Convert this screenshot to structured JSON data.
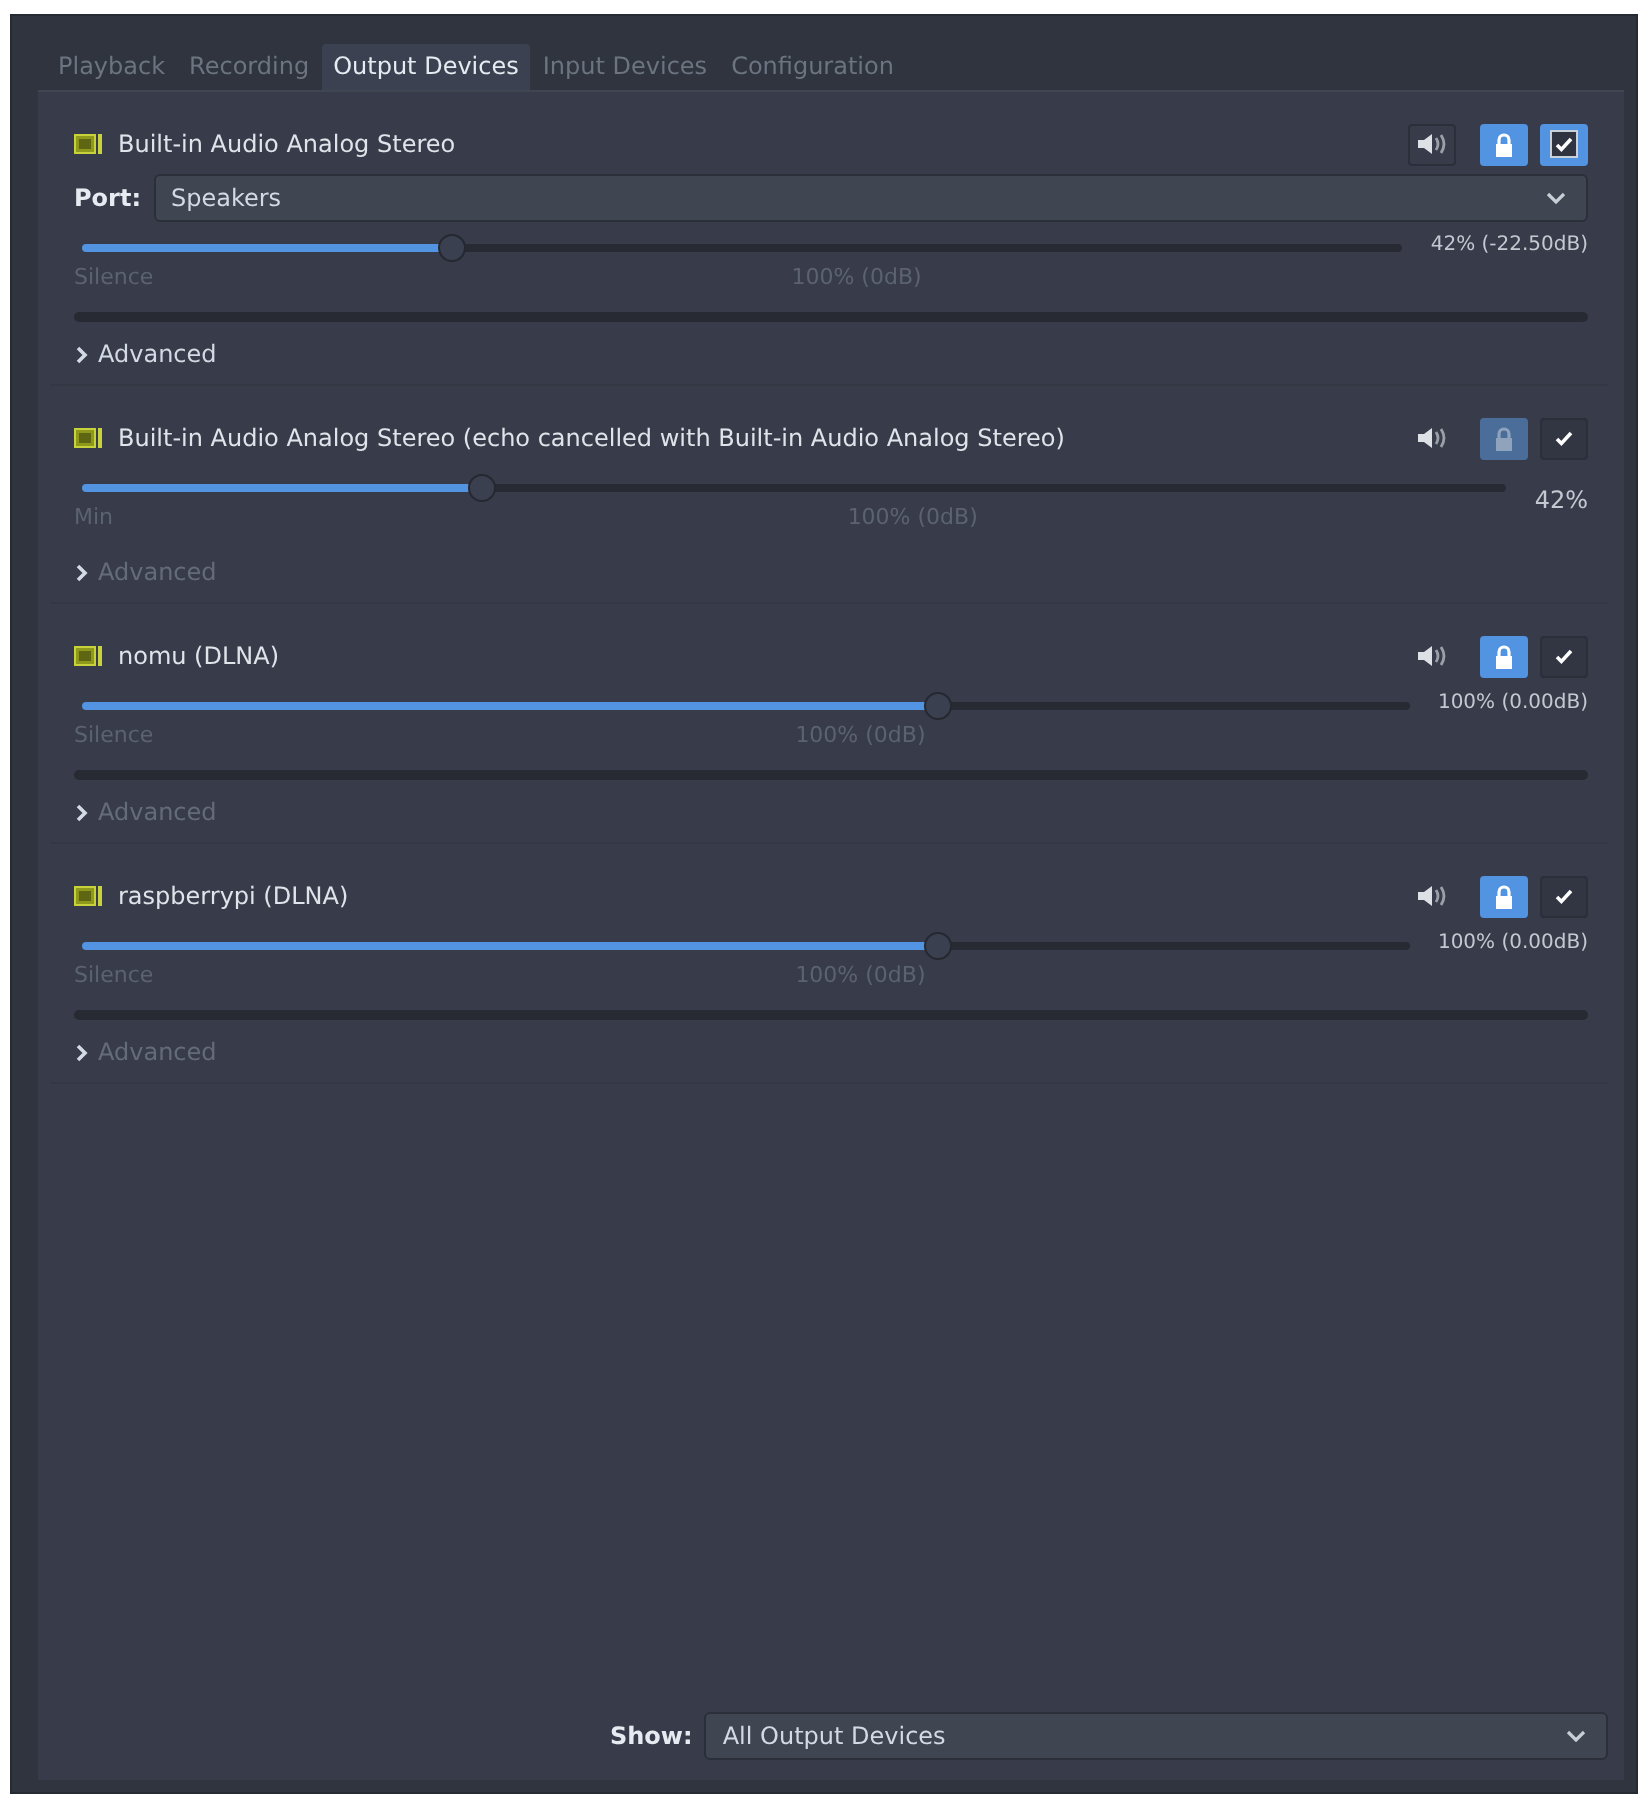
{
  "tabs": [
    {
      "label": "Playback",
      "selected": false
    },
    {
      "label": "Recording",
      "selected": false
    },
    {
      "label": "Output Devices",
      "selected": true
    },
    {
      "label": "Input Devices",
      "selected": false
    },
    {
      "label": "Configuration",
      "selected": false
    }
  ],
  "devices": [
    {
      "name": "Built-in Audio Analog Stereo",
      "muted": false,
      "lock": true,
      "lock_disabled": false,
      "default": true,
      "port_label": "Port:",
      "port": "Speakers",
      "level": 0.28,
      "reading": "42% (-22.50dB)",
      "min_label": "Silence",
      "mid_label": "100% (0dB)",
      "meter": true,
      "advanced": "Advanced",
      "advanced_enabled": true
    },
    {
      "name": "Built-in Audio Analog Stereo (echo cancelled with Built-in Audio Analog Stereo)",
      "muted": false,
      "lock": true,
      "lock_disabled": true,
      "default": false,
      "level": 0.28,
      "reading": "42%",
      "min_label": "Min",
      "mid_label": "100% (0dB)",
      "meter": false,
      "advanced": "Advanced",
      "advanced_enabled": false
    },
    {
      "name": "nomu (DLNA)",
      "muted": false,
      "lock": true,
      "lock_disabled": false,
      "default": false,
      "level": 0.65,
      "reading": "100% (0.00dB)",
      "min_label": "Silence",
      "mid_label": "100% (0dB)",
      "meter": true,
      "advanced": "Advanced",
      "advanced_enabled": false
    },
    {
      "name": "raspberrypi (DLNA)",
      "muted": false,
      "lock": true,
      "lock_disabled": false,
      "default": false,
      "level": 0.65,
      "reading": "100% (0.00dB)",
      "min_label": "Silence",
      "mid_label": "100% (0dB)",
      "meter": true,
      "advanced": "Advanced",
      "advanced_enabled": false
    }
  ],
  "show": {
    "label": "Show:",
    "value": "All Output Devices"
  }
}
